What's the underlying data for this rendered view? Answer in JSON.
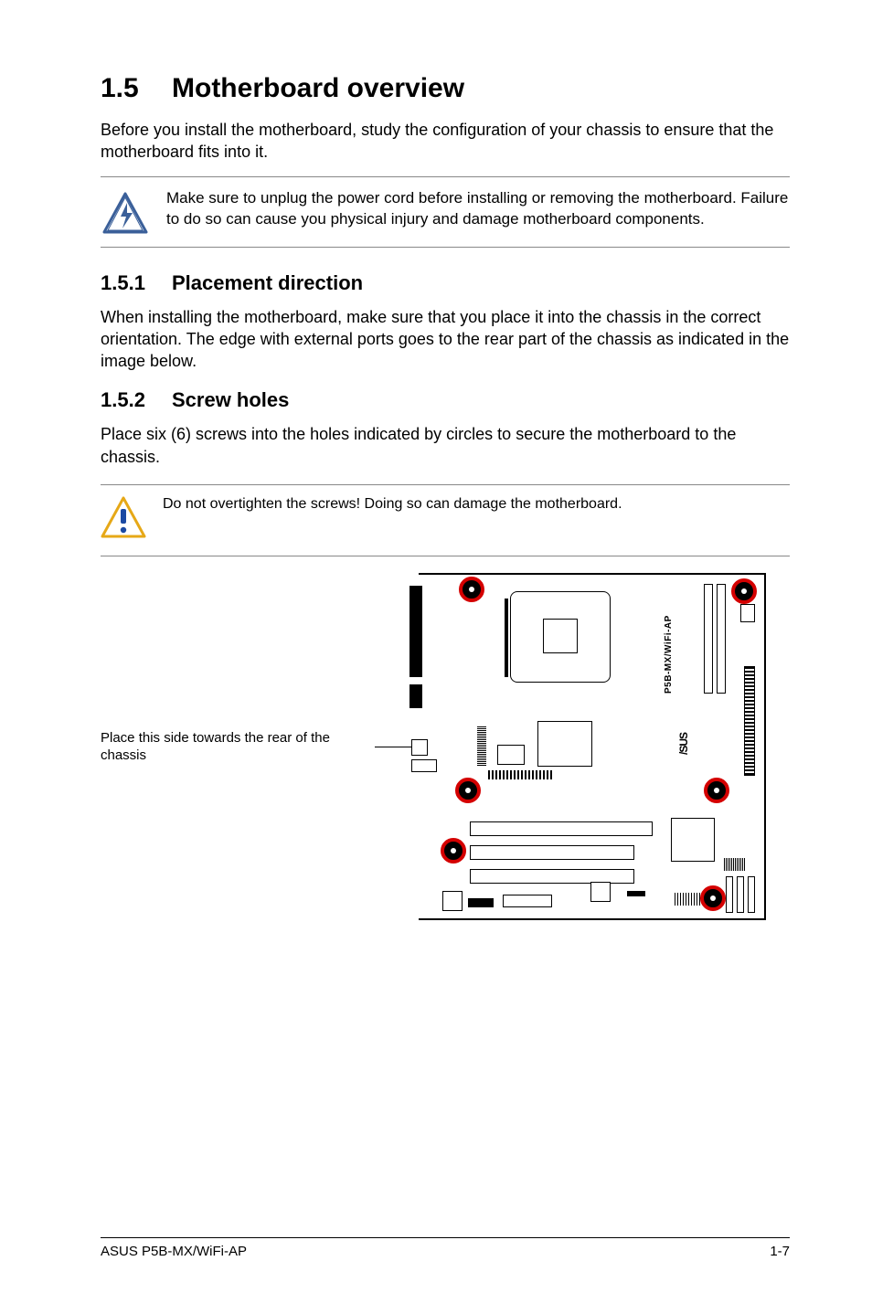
{
  "section": {
    "number": "1.5",
    "title": "Motherboard overview",
    "intro": "Before you install the motherboard, study the configuration of your chassis to ensure that the motherboard fits into it."
  },
  "callout_power": {
    "icon": "lightning-triangle-icon",
    "text": "Make sure to unplug the power cord before installing or removing the motherboard. Failure to do so can cause you physical injury and damage motherboard components."
  },
  "sub1": {
    "number": "1.5.1",
    "title": "Placement direction",
    "body": "When installing the motherboard, make sure that you place it into the chassis in the correct orientation. The edge with external ports goes to the rear part of the chassis as indicated in the image below."
  },
  "sub2": {
    "number": "1.5.2",
    "title": "Screw holes",
    "body": "Place six (6) screws into the holes indicated by circles to secure the motherboard to the chassis."
  },
  "callout_overtighten": {
    "icon": "caution-icon",
    "text": "Do not overtighten the screws! Doing so can damage the motherboard."
  },
  "diagram": {
    "caption": "Place this side towards the rear of the chassis",
    "board_label": "P5B-MX/WiFi-AP"
  },
  "footer": {
    "left": "ASUS P5B-MX/WiFi-AP",
    "right": "1-7"
  }
}
